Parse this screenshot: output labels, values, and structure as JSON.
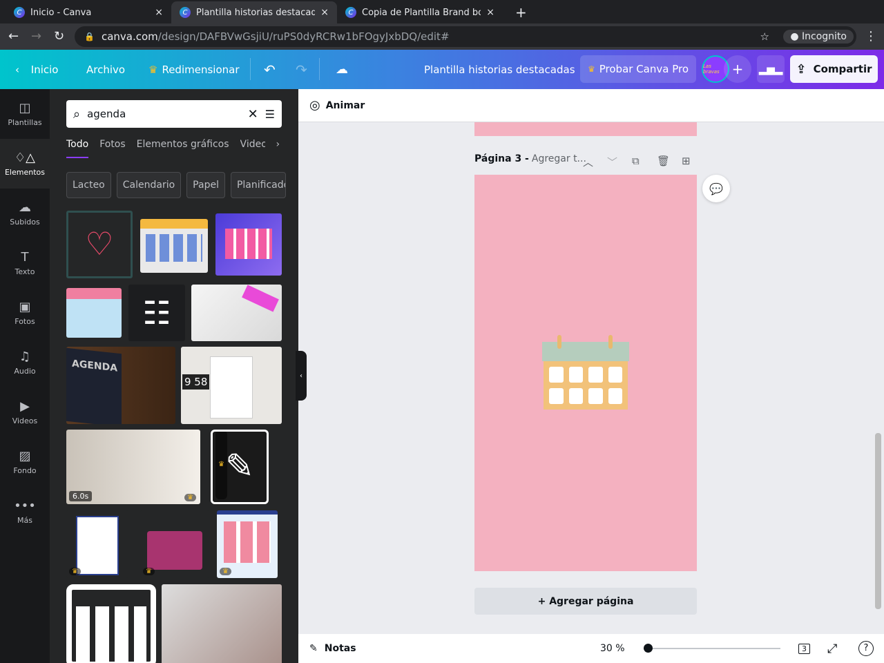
{
  "browser": {
    "tabs": [
      {
        "title": "Inicio - Canva"
      },
      {
        "title": "Plantilla historias destacadas"
      },
      {
        "title": "Copia de Plantilla Brand book"
      }
    ],
    "url_domain": "canva.com",
    "url_path": "/design/DAFBVwGsjiU/ruPS0dyRCRw1bFOgyJxbDQ/edit#",
    "incognito": "Incognito"
  },
  "topbar": {
    "home": "Inicio",
    "file": "Archivo",
    "resize": "Redimensionar",
    "title": "Plantilla historias destacadas",
    "pro": "Probar Canva Pro",
    "share": "Compartir",
    "avatar_text": "Las bravas"
  },
  "sidebar": {
    "items": [
      {
        "label": "Plantillas",
        "icon": "template-icon"
      },
      {
        "label": "Elementos",
        "icon": "elements-icon"
      },
      {
        "label": "Subidos",
        "icon": "upload-icon"
      },
      {
        "label": "Texto",
        "icon": "text-icon"
      },
      {
        "label": "Fotos",
        "icon": "photo-icon"
      },
      {
        "label": "Audio",
        "icon": "audio-icon"
      },
      {
        "label": "Videos",
        "icon": "video-icon"
      },
      {
        "label": "Fondo",
        "icon": "background-icon"
      },
      {
        "label": "Más",
        "icon": "more-icon"
      }
    ]
  },
  "panel": {
    "search_value": "agenda",
    "tabs": [
      "Todo",
      "Fotos",
      "Elementos gráficos",
      "Videos"
    ],
    "chips": [
      "Lacteo",
      "Calendario",
      "Papel",
      "Planificador"
    ],
    "image_texts": {
      "agenda": "AGENDA",
      "clock": "9 58",
      "video_duration": "6.0s"
    }
  },
  "editor": {
    "animate": "Animar",
    "page_label": "Página 3 -",
    "page_title_placeholder": "Agregar t...",
    "add_page": "+ Agregar página",
    "notes": "Notas",
    "zoom": "30 %",
    "page_count": "3"
  },
  "colors": {
    "page": "#f4b1c0",
    "accent": "#8b3dff"
  }
}
